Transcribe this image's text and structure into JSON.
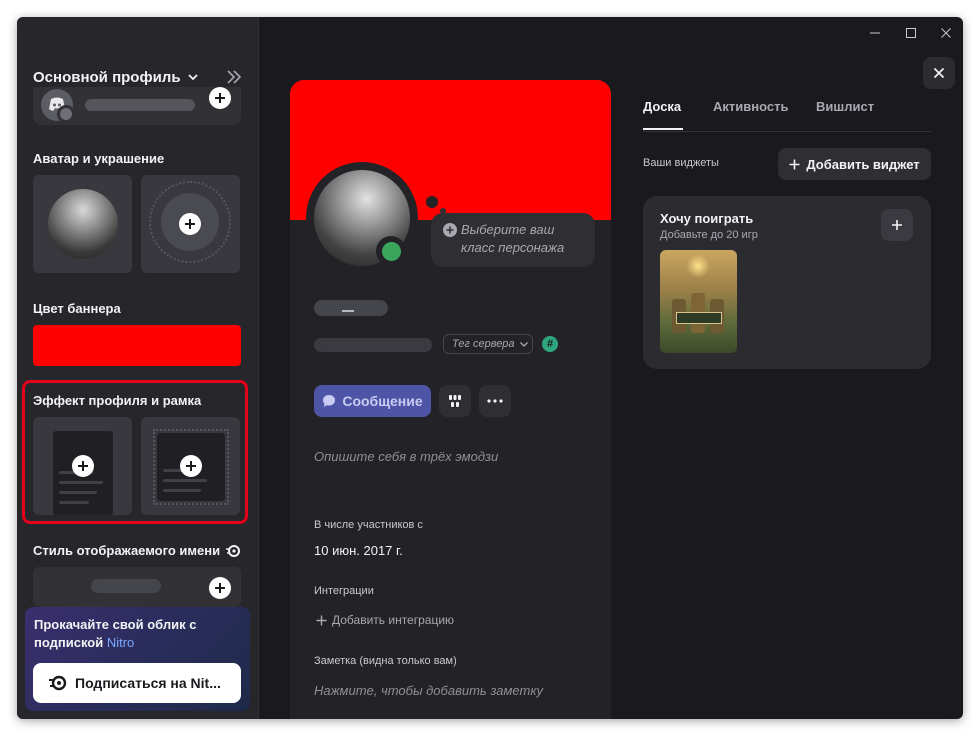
{
  "sidebar": {
    "profile_selector": "Основной профиль",
    "avatar_section": "Аватар и украшение",
    "banner_section": "Цвет баннера",
    "banner_color": "#ff0000",
    "effect_section": "Эффект профиля и рамка",
    "name_style_section": "Стиль отображаемого имени",
    "nitro": {
      "promo_text": "Прокачайте свой облик с подпиской",
      "promo_highlight": "Nitro",
      "subscribe_button": "Подписаться на Nit..."
    }
  },
  "profile_card": {
    "class_prompt": "Выберите ваш класс персонажа",
    "server_tag": "Тег сервера",
    "hash_badge": "#",
    "message_button": "Сообщение",
    "emoji_prompt": "Опишите себя в трёх эмодзи",
    "member_since_label": "В числе участников с",
    "member_since_value": "10 июн. 2017 г.",
    "integrations_label": "Интеграции",
    "add_integration": "Добавить интеграцию",
    "note_label": "Заметка (видна только вам)",
    "note_placeholder": "Нажмите, чтобы добавить заметку",
    "status_color": "#3ba55d"
  },
  "right_panel": {
    "tabs": [
      {
        "label": "Доска"
      },
      {
        "label": "Активность"
      },
      {
        "label": "Вишлист"
      }
    ],
    "widgets_label": "Ваши виджеты",
    "add_widget": "Добавить виджет",
    "widget": {
      "title": "Хочу поиграть",
      "subtitle": "Добавьте до 20 игр"
    }
  },
  "icons": {
    "minimize": "minimize-icon",
    "maximize": "maximize-icon",
    "close": "close-icon"
  }
}
